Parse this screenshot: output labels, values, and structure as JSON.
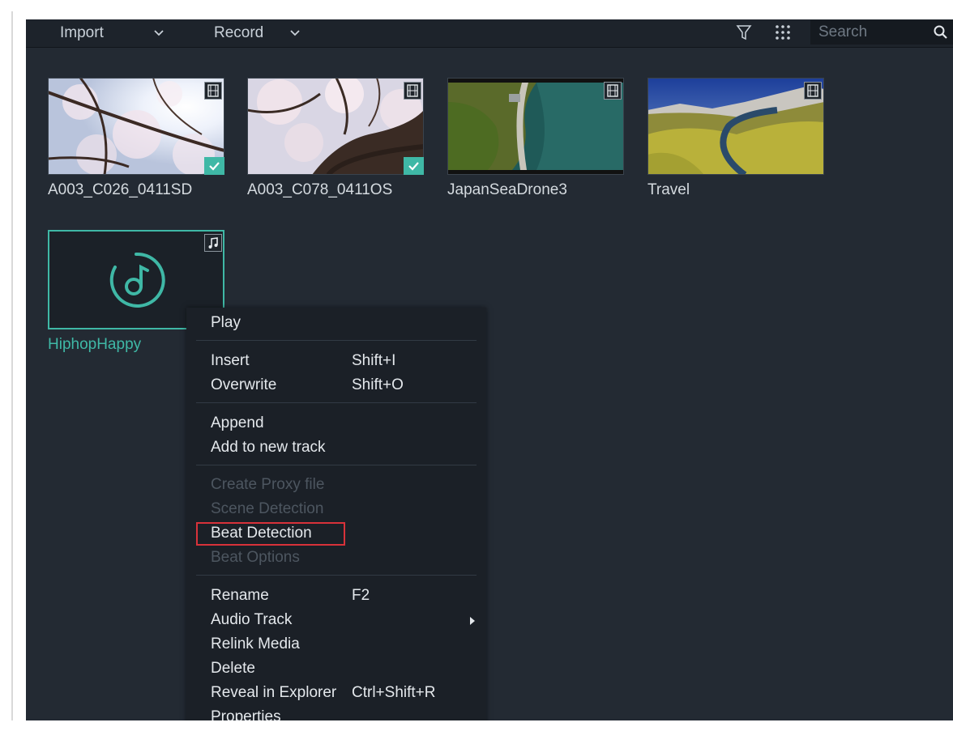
{
  "toolbar": {
    "import_label": "Import",
    "record_label": "Record",
    "search_placeholder": "Search",
    "icons": [
      "chevron-down-icon",
      "filter-icon",
      "grid-icon",
      "search-icon"
    ]
  },
  "media": [
    {
      "name": "A003_C026_0411SD",
      "type": "video",
      "checked": true
    },
    {
      "name": "A003_C078_0411OS",
      "type": "video",
      "checked": true
    },
    {
      "name": "JapanSeaDrone3",
      "type": "video",
      "checked": false
    },
    {
      "name": "Travel",
      "type": "video",
      "checked": false
    },
    {
      "name": "HiphopHappy",
      "type": "audio",
      "checked": false,
      "selected": true
    }
  ],
  "context_menu": {
    "play": "Play",
    "insert": "Insert",
    "insert_shortcut": "Shift+I",
    "overwrite": "Overwrite",
    "overwrite_shortcut": "Shift+O",
    "append": "Append",
    "add_to_new_track": "Add to new track",
    "create_proxy_file": "Create Proxy file",
    "scene_detection": "Scene Detection",
    "beat_detection": "Beat Detection",
    "beat_options": "Beat Options",
    "rename": "Rename",
    "rename_shortcut": "F2",
    "audio_track": "Audio Track",
    "relink_media": "Relink Media",
    "delete": "Delete",
    "reveal_in_explorer": "Reveal in Explorer",
    "reveal_shortcut": "Ctrl+Shift+R",
    "properties": "Properties"
  },
  "colors": {
    "accent": "#3fb8a6",
    "highlight_box": "#d8323a",
    "background": "#232a33"
  }
}
